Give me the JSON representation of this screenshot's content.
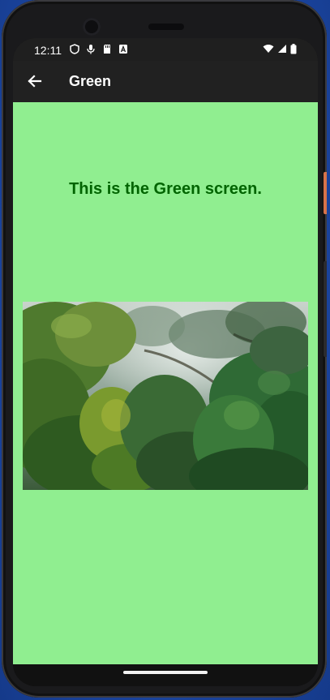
{
  "status_bar": {
    "time": "12:11",
    "left_icons": [
      "shield-icon",
      "mic-off-icon",
      "sd-card-icon",
      "a-badge-icon"
    ],
    "right_icons": [
      "wifi-icon",
      "signal-icon",
      "battery-icon"
    ]
  },
  "app_bar": {
    "back_icon": "arrow-back-icon",
    "title": "Green"
  },
  "content": {
    "headline": "This is the Green screen.",
    "image_subject": "misty forest canopy",
    "background_color": "#90ee90",
    "headline_color": "#006400"
  },
  "device": {
    "frame_color": "#1a1a1c",
    "side_button_accent": "#d8734a"
  }
}
